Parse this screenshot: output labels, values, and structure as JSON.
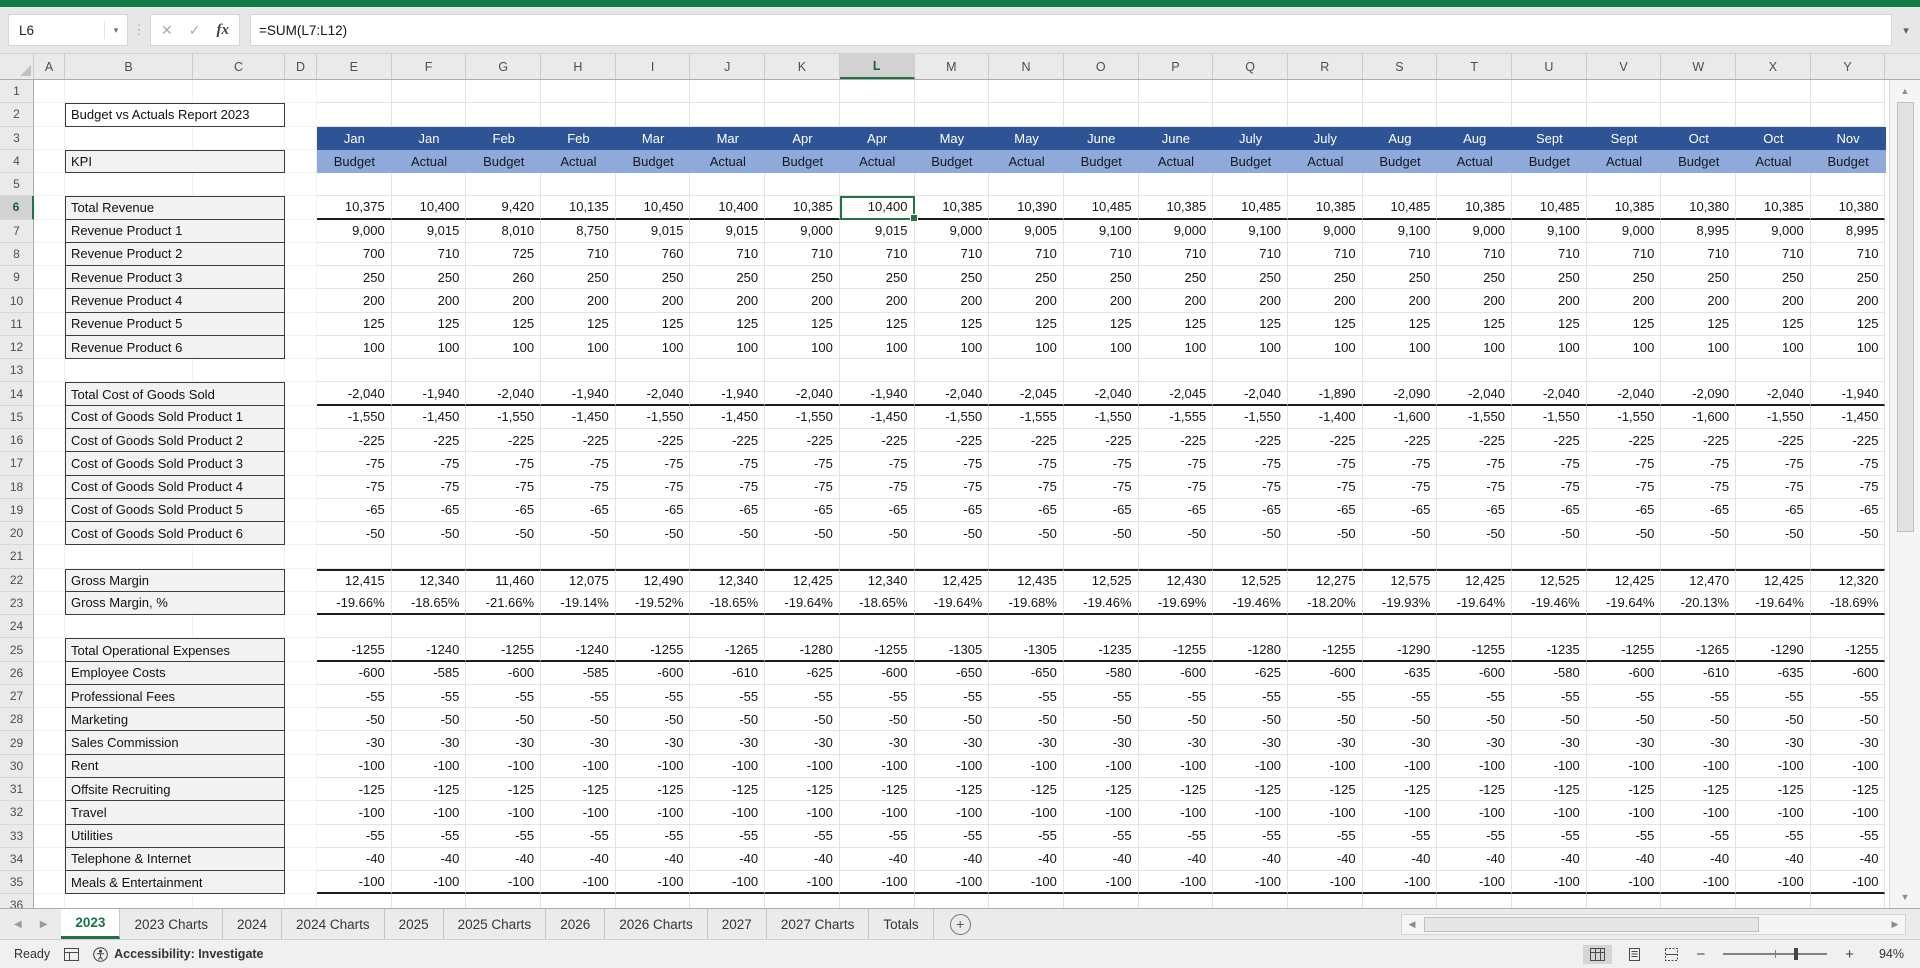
{
  "chrome": {
    "name_box": "L6",
    "formula": "=SUM(L7:L12)",
    "fx_label": "fx"
  },
  "selection": {
    "cell_ref": "L6",
    "column": "L",
    "row": 6,
    "selected_col_index": 7
  },
  "columns": [
    "A",
    "B",
    "C",
    "D",
    "E",
    "F",
    "G",
    "H",
    "I",
    "J",
    "K",
    "L",
    "M",
    "N",
    "O",
    "P",
    "Q",
    "R",
    "S",
    "T",
    "U",
    "V",
    "W",
    "X",
    "Y"
  ],
  "row_count": 36,
  "sheet": {
    "title": "Budget vs Actuals Report 2023",
    "kpi_label": "KPI",
    "months": [
      "Jan",
      "Jan",
      "Feb",
      "Feb",
      "Mar",
      "Mar",
      "Apr",
      "Apr",
      "May",
      "May",
      "June",
      "June",
      "July",
      "July",
      "Aug",
      "Aug",
      "Sept",
      "Sept",
      "Oct",
      "Oct",
      "Nov"
    ],
    "period_types": [
      "Budget",
      "Actual",
      "Budget",
      "Actual",
      "Budget",
      "Actual",
      "Budget",
      "Actual",
      "Budget",
      "Actual",
      "Budget",
      "Actual",
      "Budget",
      "Actual",
      "Budget",
      "Actual",
      "Budget",
      "Actual",
      "Budget",
      "Actual",
      "Budget"
    ],
    "sections": [
      {
        "name": "revenue",
        "rows": [
          {
            "row": 6,
            "label": "Total Revenue",
            "total": true,
            "values": [
              "10,375",
              "10,400",
              "9,420",
              "10,135",
              "10,450",
              "10,400",
              "10,385",
              "10,400",
              "10,385",
              "10,390",
              "10,485",
              "10,385",
              "10,485",
              "10,385",
              "10,485",
              "10,385",
              "10,485",
              "10,385",
              "10,380",
              "10,385",
              "10,380"
            ]
          },
          {
            "row": 7,
            "label": "Revenue Product 1",
            "values": [
              "9,000",
              "9,015",
              "8,010",
              "8,750",
              "9,015",
              "9,015",
              "9,000",
              "9,015",
              "9,000",
              "9,005",
              "9,100",
              "9,000",
              "9,100",
              "9,000",
              "9,100",
              "9,000",
              "9,100",
              "9,000",
              "8,995",
              "9,000",
              "8,995"
            ]
          },
          {
            "row": 8,
            "label": "Revenue Product 2",
            "values": [
              "700",
              "710",
              "725",
              "710",
              "760",
              "710",
              "710",
              "710",
              "710",
              "710",
              "710",
              "710",
              "710",
              "710",
              "710",
              "710",
              "710",
              "710",
              "710",
              "710",
              "710"
            ]
          },
          {
            "row": 9,
            "label": "Revenue Product 3",
            "values": [
              "250",
              "250",
              "260",
              "250",
              "250",
              "250",
              "250",
              "250",
              "250",
              "250",
              "250",
              "250",
              "250",
              "250",
              "250",
              "250",
              "250",
              "250",
              "250",
              "250",
              "250"
            ]
          },
          {
            "row": 10,
            "label": "Revenue Product 4",
            "fill": "200"
          },
          {
            "row": 11,
            "label": "Revenue Product 5",
            "fill": "125"
          },
          {
            "row": 12,
            "label": "Revenue Product 6",
            "fill": "100"
          }
        ]
      },
      {
        "name": "cogs",
        "rows": [
          {
            "row": 14,
            "label": "Total Cost of Goods Sold",
            "total": true,
            "values": [
              "-2,040",
              "-1,940",
              "-2,040",
              "-1,940",
              "-2,040",
              "-1,940",
              "-2,040",
              "-1,940",
              "-2,040",
              "-2,045",
              "-2,040",
              "-2,045",
              "-2,040",
              "-1,890",
              "-2,090",
              "-2,040",
              "-2,040",
              "-2,040",
              "-2,090",
              "-2,040",
              "-1,940"
            ]
          },
          {
            "row": 15,
            "label": "Cost of Goods Sold Product 1",
            "values": [
              "-1,550",
              "-1,450",
              "-1,550",
              "-1,450",
              "-1,550",
              "-1,450",
              "-1,550",
              "-1,450",
              "-1,550",
              "-1,555",
              "-1,550",
              "-1,555",
              "-1,550",
              "-1,400",
              "-1,600",
              "-1,550",
              "-1,550",
              "-1,550",
              "-1,600",
              "-1,550",
              "-1,450"
            ]
          },
          {
            "row": 16,
            "label": "Cost of Goods Sold Product 2",
            "fill": "-225"
          },
          {
            "row": 17,
            "label": "Cost of Goods Sold Product 3",
            "fill": "-75"
          },
          {
            "row": 18,
            "label": "Cost of Goods Sold Product 4",
            "fill": "-75"
          },
          {
            "row": 19,
            "label": "Cost of Goods Sold Product 5",
            "fill": "-65"
          },
          {
            "row": 20,
            "label": "Cost of Goods Sold Product 6",
            "fill": "-50"
          }
        ]
      },
      {
        "name": "gross-margin",
        "rows": [
          {
            "row": 22,
            "label": "Gross Margin",
            "border_top": true,
            "values": [
              "12,415",
              "12,340",
              "11,460",
              "12,075",
              "12,490",
              "12,340",
              "12,425",
              "12,340",
              "12,425",
              "12,435",
              "12,525",
              "12,430",
              "12,525",
              "12,275",
              "12,575",
              "12,425",
              "12,525",
              "12,425",
              "12,470",
              "12,425",
              "12,320"
            ]
          },
          {
            "row": 23,
            "label": "Gross Margin, %",
            "border_bottom": true,
            "values": [
              "-19.66%",
              "-18.65%",
              "-21.66%",
              "-19.14%",
              "-19.52%",
              "-18.65%",
              "-19.64%",
              "-18.65%",
              "-19.64%",
              "-19.68%",
              "-19.46%",
              "-19.69%",
              "-19.46%",
              "-18.20%",
              "-19.93%",
              "-19.64%",
              "-19.46%",
              "-19.64%",
              "-20.13%",
              "-19.64%",
              "-18.69%"
            ]
          }
        ]
      },
      {
        "name": "opex",
        "rows": [
          {
            "row": 25,
            "label": "Total Operational Expenses",
            "total": true,
            "values": [
              "-1255",
              "-1240",
              "-1255",
              "-1240",
              "-1255",
              "-1265",
              "-1280",
              "-1255",
              "-1305",
              "-1305",
              "-1235",
              "-1255",
              "-1280",
              "-1255",
              "-1290",
              "-1255",
              "-1235",
              "-1255",
              "-1265",
              "-1290",
              "-1255"
            ]
          },
          {
            "row": 26,
            "label": "Employee Costs",
            "values": [
              "-600",
              "-585",
              "-600",
              "-585",
              "-600",
              "-610",
              "-625",
              "-600",
              "-650",
              "-650",
              "-580",
              "-600",
              "-625",
              "-600",
              "-635",
              "-600",
              "-580",
              "-600",
              "-610",
              "-635",
              "-600"
            ]
          },
          {
            "row": 27,
            "label": "Professional Fees",
            "fill": "-55"
          },
          {
            "row": 28,
            "label": "Marketing",
            "fill": "-50"
          },
          {
            "row": 29,
            "label": "Sales Commission",
            "fill": "-30"
          },
          {
            "row": 30,
            "label": "Rent",
            "fill": "-100"
          },
          {
            "row": 31,
            "label": "Offsite Recruiting",
            "fill": "-125"
          },
          {
            "row": 32,
            "label": "Travel",
            "fill": "-100"
          },
          {
            "row": 33,
            "label": "Utilities",
            "fill": "-55"
          },
          {
            "row": 34,
            "label": "Telephone & Internet",
            "fill": "-40"
          },
          {
            "row": 35,
            "label": "Meals & Entertainment",
            "border_bottom": true,
            "fill": "-100"
          }
        ]
      }
    ]
  },
  "tabs": {
    "items": [
      "2023",
      "2023 Charts",
      "2024",
      "2024 Charts",
      "2025",
      "2025 Charts",
      "2026",
      "2026 Charts",
      "2027",
      "2027 Charts",
      "Totals"
    ],
    "active": "2023",
    "new_sheet_label": "+"
  },
  "status_bar": {
    "ready": "Ready",
    "accessibility": "Accessibility: Investigate",
    "zoom": "94%"
  },
  "colors": {
    "excel_green": "#107C41",
    "selection_green": "#217346",
    "month_header_bg": "#2F5496",
    "type_header_bg": "#8EAADB",
    "label_fill": "#F2F2F2"
  }
}
